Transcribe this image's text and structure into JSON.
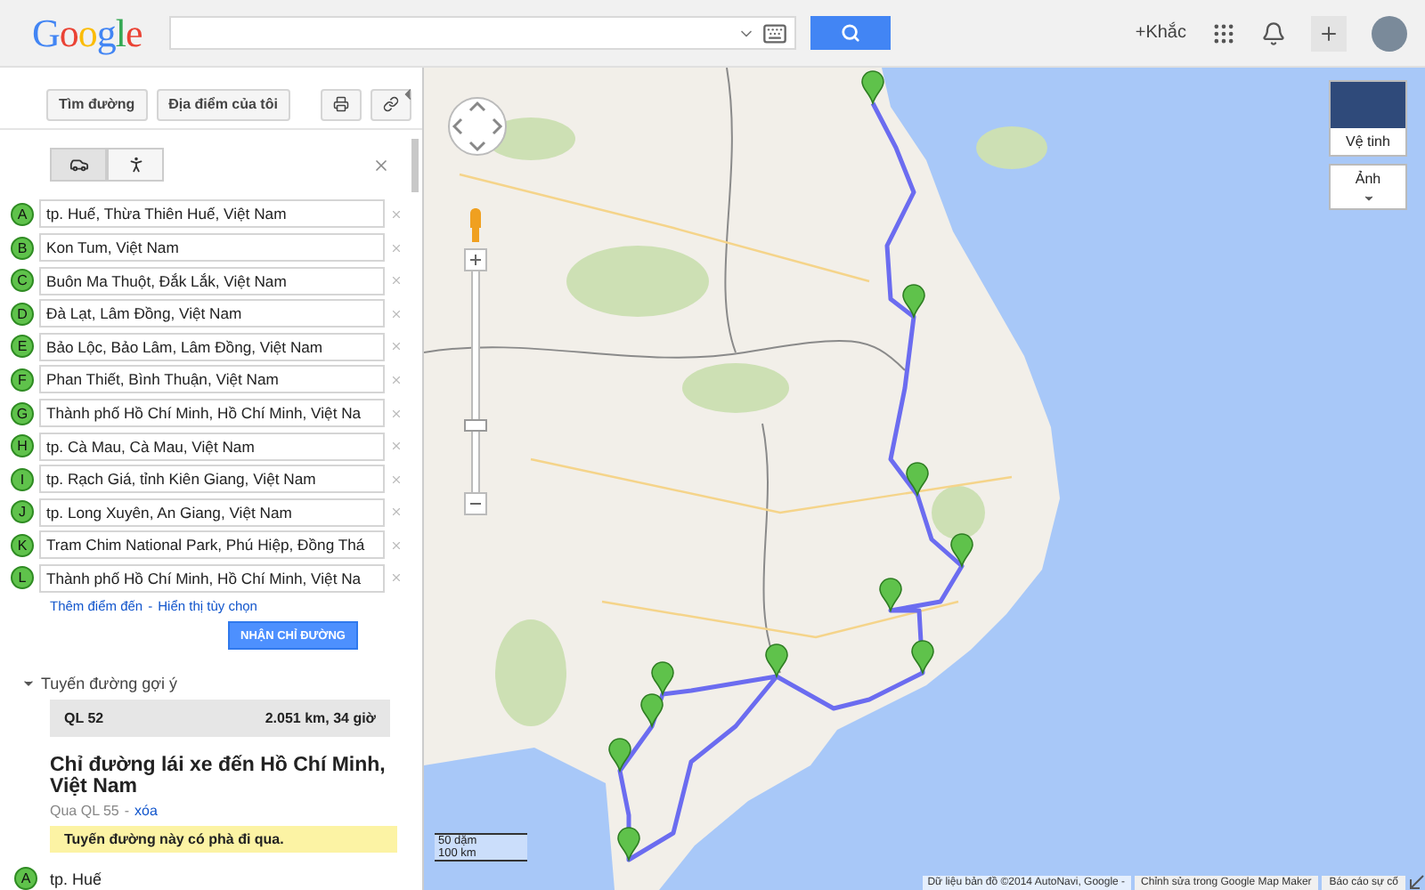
{
  "header": {
    "logo": "Google",
    "more_label": "+Khắc"
  },
  "sidebar": {
    "top_buttons": [
      {
        "label": "Tìm đường"
      },
      {
        "label": "Địa điểm của tôi"
      }
    ],
    "travel_modes": [
      {
        "kind": "car",
        "selected": true
      },
      {
        "kind": "walk",
        "selected": false
      }
    ],
    "waypoints": [
      {
        "marker": "A",
        "value": "tp. Huế, Thừa Thiên Huế, Việt Nam"
      },
      {
        "marker": "B",
        "value": "Kon Tum, Việt Nam"
      },
      {
        "marker": "C",
        "value": "Buôn Ma Thuột, Đắk Lắk, Việt Nam"
      },
      {
        "marker": "D",
        "value": "Đà Lạt, Lâm Đồng, Việt Nam"
      },
      {
        "marker": "E",
        "value": "Bảo Lộc, Bảo Lâm, Lâm Đồng, Việt Nam"
      },
      {
        "marker": "F",
        "value": "Phan Thiết, Bình Thuận, Việt Nam"
      },
      {
        "marker": "G",
        "value": "Thành phố Hồ Chí Minh, Hồ Chí Minh, Việt Na"
      },
      {
        "marker": "H",
        "value": "tp. Cà Mau, Cà Mau, Việt Nam"
      },
      {
        "marker": "I",
        "value": "tp. Rạch Giá, tỉnh Kiên Giang, Việt Nam"
      },
      {
        "marker": "J",
        "value": "tp. Long Xuyên, An Giang, Việt Nam"
      },
      {
        "marker": "K",
        "value": "Tram Chim National Park, Phú Hiệp, Đồng Thá"
      },
      {
        "marker": "L",
        "value": "Thành phố Hồ Chí Minh, Hồ Chí Minh, Việt Na"
      }
    ],
    "add_links": {
      "add": "Thêm điểm đến",
      "separator": "-",
      "options": "Hiển thị tùy chọn"
    },
    "get_directions": "NHẬN CHỈ ĐƯỜNG",
    "suggested_routes": {
      "title": "Tuyến đường gợi ý",
      "expanded": true,
      "routes": [
        {
          "name": "QL 52",
          "distance_time": "2.051 km, 34 giờ",
          "selected": true
        }
      ]
    },
    "directions": {
      "title": "Chỉ đường lái xe đến Hồ Chí Minh, Việt Nam",
      "via": "Qua QL 55",
      "separator": "-",
      "clear_link": "xóa",
      "notice": "Tuyến đường này có phà đi qua.",
      "first_step": {
        "marker": "A",
        "place": "tp. Huế"
      }
    }
  },
  "map": {
    "layers": [
      {
        "kind": "satellite",
        "label": "Vệ tinh"
      },
      {
        "kind": "dropdown",
        "label": "Ảnh"
      }
    ],
    "scale": [
      "50 dặm",
      "100 km"
    ],
    "footer": {
      "attribution": "Dữ liệu bản đồ ©2014 AutoNavi, Google -",
      "links": [
        "Chỉnh sửa trong Google Map Maker",
        "Báo cáo sự cố"
      ]
    }
  }
}
